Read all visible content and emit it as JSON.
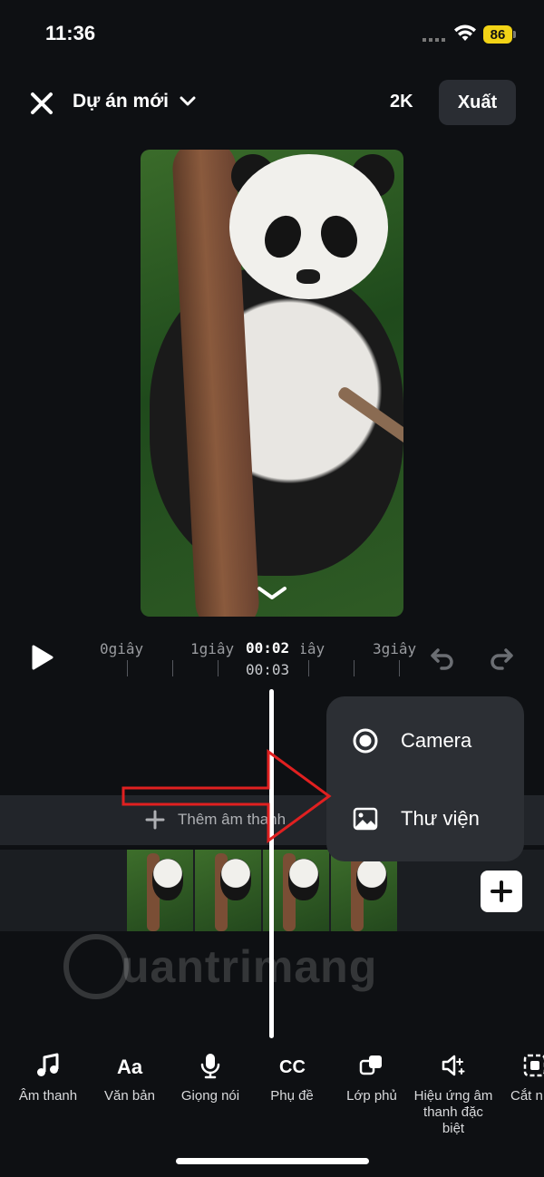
{
  "status_bar": {
    "time": "11:36",
    "battery": "86"
  },
  "header": {
    "title": "Dự án mới",
    "resolution": "2K",
    "export_label": "Xuất"
  },
  "playback": {
    "ticks": [
      "0giây",
      "1giây",
      "2giây",
      "3giây"
    ],
    "current_time": "00:02",
    "total_time": "00:03"
  },
  "timeline": {
    "add_audio_label": "Thêm âm thanh"
  },
  "add_media_menu": {
    "items": [
      "Camera",
      "Thư viện"
    ]
  },
  "watermark": "uantrimang",
  "toolbar": {
    "items": [
      {
        "label": "Âm thanh",
        "icon": "music-note-icon"
      },
      {
        "label": "Văn bản",
        "icon": "text-aa-icon"
      },
      {
        "label": "Giọng nói",
        "icon": "microphone-icon"
      },
      {
        "label": "Phụ đề",
        "icon": "captions-cc-icon"
      },
      {
        "label": "Lớp phủ",
        "icon": "overlay-icon"
      },
      {
        "label": "Hiệu ứng âm thanh đặc biệt",
        "icon": "sound-effect-icon"
      },
      {
        "label": "Cắt n",
        "icon": "crop-icon"
      }
    ]
  }
}
